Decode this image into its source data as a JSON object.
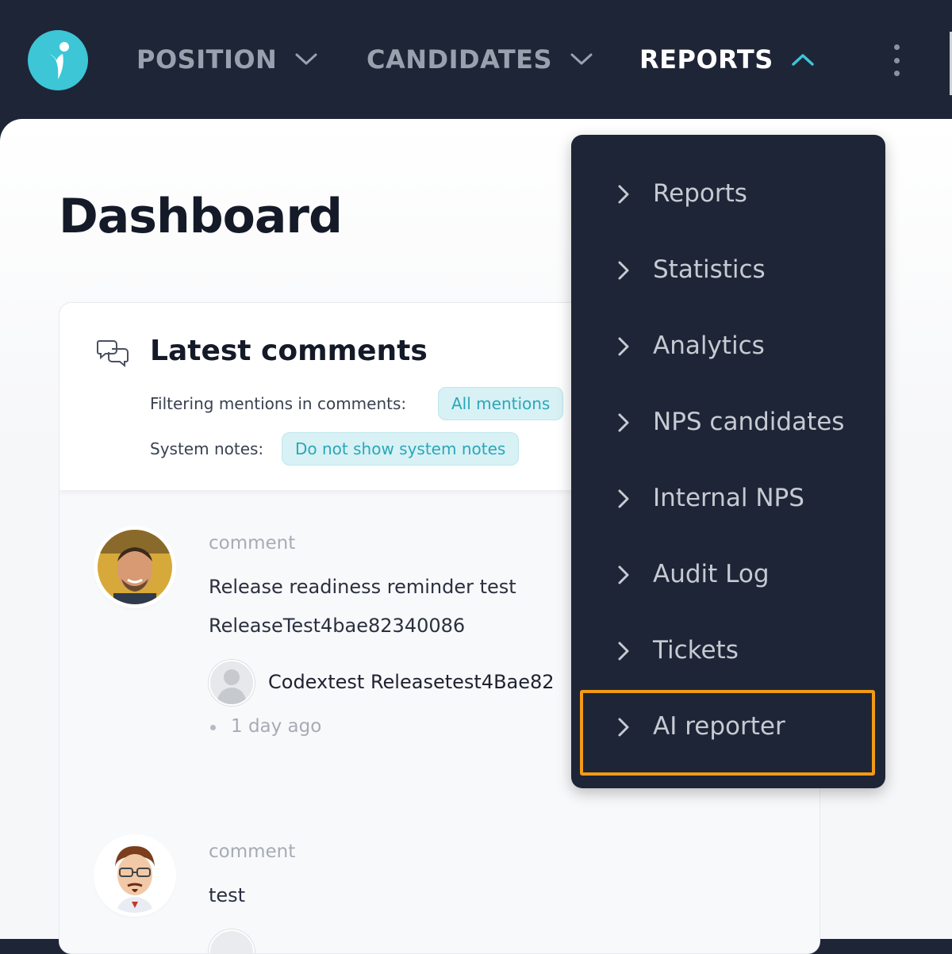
{
  "nav": {
    "items": [
      {
        "label": "POSITION",
        "icon": "chevron-down-icon",
        "active": false
      },
      {
        "label": "CANDIDATES",
        "icon": "chevron-down-icon",
        "active": false
      },
      {
        "label": "REPORTS",
        "icon": "chevron-up-icon",
        "active": true
      }
    ],
    "more_icon": "kebab-menu-icon"
  },
  "page": {
    "title": "Dashboard"
  },
  "comments_card": {
    "title": "Latest comments",
    "icon": "comments-icon",
    "filter_label": "Filtering mentions in comments:",
    "filter_value": "All mentions",
    "system_label": "System notes:",
    "system_value": "Do not show system notes"
  },
  "entries": [
    {
      "type": "comment",
      "text_line1": "Release readiness reminder test",
      "text_line2": "ReleaseTest4bae82340086",
      "author": "Codextest Releasetest4Bae82",
      "time": "1 day ago"
    },
    {
      "type": "comment",
      "text_line1": "test"
    }
  ],
  "reports_menu": {
    "items": [
      {
        "label": "Reports"
      },
      {
        "label": "Statistics"
      },
      {
        "label": "Analytics"
      },
      {
        "label": "NPS candidates"
      },
      {
        "label": "Internal NPS"
      },
      {
        "label": "Audit Log"
      },
      {
        "label": "Tickets"
      },
      {
        "label": "AI reporter",
        "highlighted": true
      }
    ]
  },
  "colors": {
    "nav_bg": "#1e2537",
    "accent": "#3cc6d6",
    "chip_text": "#2aa7b8",
    "highlight": "#f29a16"
  }
}
